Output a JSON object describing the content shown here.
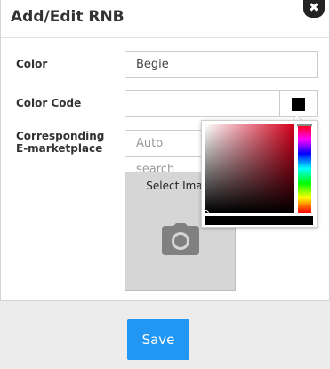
{
  "modal": {
    "title": "Add/Edit RNB",
    "close_glyph": "✖"
  },
  "form": {
    "color_label": "Color",
    "color_value": "Begie",
    "color_code_label": "Color Code",
    "color_code_value": "",
    "swatch_color": "#000000",
    "marketplace_label_line1": "Corresponding",
    "marketplace_label_line2": "E-marketplace",
    "marketplace_placeholder": "Auto search",
    "upload_label": "Select Image",
    "upload_icon": "camera-icon"
  },
  "color_picker": {
    "hue_color": "#d4001c",
    "selected_color": "#000000"
  },
  "footer": {
    "save_label": "Save",
    "save_color": "#2196f3"
  }
}
